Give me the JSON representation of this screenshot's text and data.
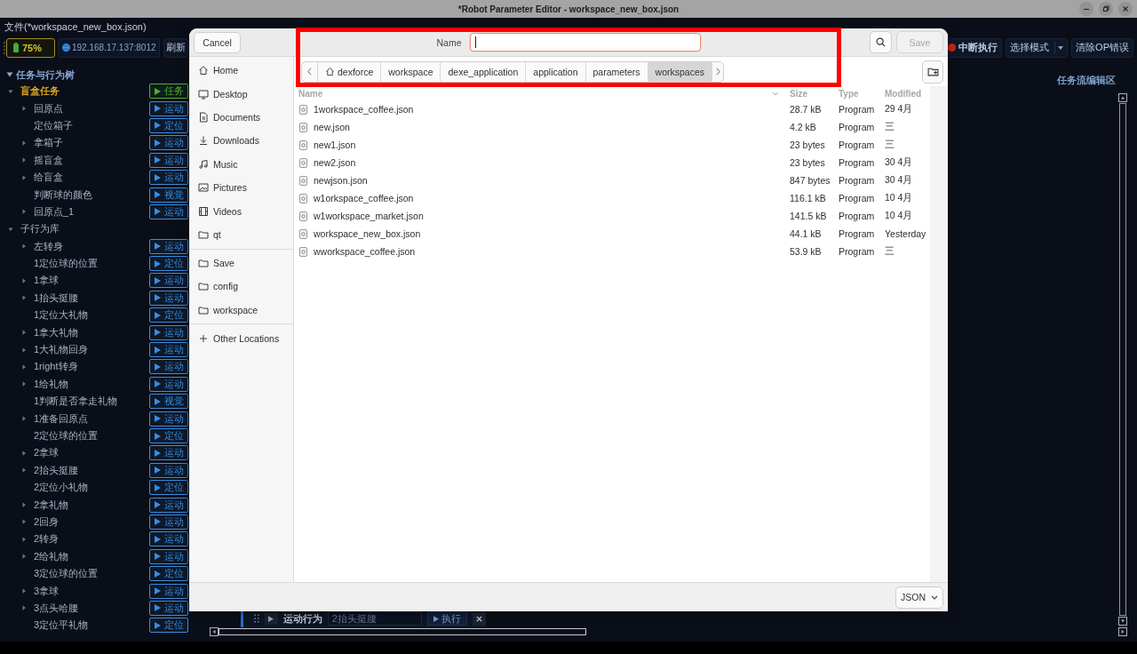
{
  "window": {
    "title": "*Robot Parameter Editor - workspace_new_box.json"
  },
  "menu": {
    "file_label": "文件(*workspace_new_box.json)"
  },
  "toolbar": {
    "battery": "75%",
    "address": "192.168.17.137:8012",
    "left_buttons": [
      {
        "label": "刷新",
        "kind": "plain"
      }
    ],
    "right_buttons": [
      {
        "label": "中断执行",
        "kind": "stop"
      },
      {
        "label": "选择模式",
        "kind": "dropdown"
      },
      {
        "label": "清除OP错误",
        "kind": "plain"
      }
    ]
  },
  "tree": {
    "title": "任务与行为树",
    "expanded": true,
    "items": [
      {
        "label": "盲盒任务",
        "selected": true,
        "expandable": true,
        "expanded": true,
        "badge": {
          "label": "任务",
          "color": "#4fb22f"
        },
        "children": [
          {
            "label": "回原点",
            "selected": false,
            "expandable": true,
            "expanded": false,
            "badge": {
              "label": "运动",
              "color": "#3a8de0"
            }
          },
          {
            "label": "定位箱子",
            "selected": false,
            "expandable": false,
            "expanded": false,
            "badge": {
              "label": "定位",
              "color": "#3a8de0"
            }
          },
          {
            "label": "拿箱子",
            "selected": false,
            "expandable": true,
            "expanded": false,
            "badge": {
              "label": "运动",
              "color": "#3a8de0"
            }
          },
          {
            "label": "摇盲盒",
            "selected": false,
            "expandable": true,
            "expanded": false,
            "badge": {
              "label": "运动",
              "color": "#3a8de0"
            }
          },
          {
            "label": "给盲盒",
            "selected": false,
            "expandable": true,
            "expanded": false,
            "badge": {
              "label": "运动",
              "color": "#3a8de0"
            }
          },
          {
            "label": "判断球的颜色",
            "selected": false,
            "expandable": false,
            "expanded": false,
            "badge": {
              "label": "视觉",
              "color": "#3a8de0"
            }
          },
          {
            "label": "回原点_1",
            "selected": false,
            "expandable": true,
            "expanded": false,
            "badge": {
              "label": "运动",
              "color": "#3a8de0"
            }
          }
        ]
      },
      {
        "label": "子行为库",
        "selected": false,
        "expandable": true,
        "expanded": true,
        "children": [
          {
            "label": "左转身",
            "selected": false,
            "expandable": true,
            "expanded": false,
            "badge": {
              "label": "运动",
              "color": "#3a8de0"
            }
          },
          {
            "label": "1定位球的位置",
            "selected": false,
            "expandable": false,
            "expanded": false,
            "badge": {
              "label": "定位",
              "color": "#3a8de0"
            }
          },
          {
            "label": "1拿球",
            "selected": false,
            "expandable": true,
            "expanded": false,
            "badge": {
              "label": "运动",
              "color": "#3a8de0"
            }
          },
          {
            "label": "1抬头挺腰",
            "selected": false,
            "expandable": true,
            "expanded": false,
            "badge": {
              "label": "运动",
              "color": "#3a8de0"
            }
          },
          {
            "label": "1定位大礼物",
            "selected": false,
            "expandable": false,
            "expanded": false,
            "badge": {
              "label": "定位",
              "color": "#3a8de0"
            }
          },
          {
            "label": "1拿大礼物",
            "selected": false,
            "expandable": true,
            "expanded": false,
            "badge": {
              "label": "运动",
              "color": "#3a8de0"
            }
          },
          {
            "label": "1大礼物回身",
            "selected": false,
            "expandable": true,
            "expanded": false,
            "badge": {
              "label": "运动",
              "color": "#3a8de0"
            }
          },
          {
            "label": "1right转身",
            "selected": false,
            "expandable": true,
            "expanded": false,
            "badge": {
              "label": "运动",
              "color": "#3a8de0"
            }
          },
          {
            "label": "1给礼物",
            "selected": false,
            "expandable": true,
            "expanded": false,
            "badge": {
              "label": "运动",
              "color": "#3a8de0"
            }
          },
          {
            "label": "1判断是否拿走礼物",
            "selected": false,
            "expandable": false,
            "expanded": false,
            "badge": {
              "label": "视觉",
              "color": "#3a8de0"
            }
          },
          {
            "label": "1准备回原点",
            "selected": false,
            "expandable": true,
            "expanded": false,
            "badge": {
              "label": "运动",
              "color": "#3a8de0"
            }
          },
          {
            "label": "2定位球的位置",
            "selected": false,
            "expandable": false,
            "expanded": false,
            "badge": {
              "label": "定位",
              "color": "#3a8de0"
            }
          },
          {
            "label": "2拿球",
            "selected": false,
            "expandable": true,
            "expanded": false,
            "badge": {
              "label": "运动",
              "color": "#3a8de0"
            }
          },
          {
            "label": "2抬头挺腰",
            "selected": false,
            "expandable": true,
            "expanded": false,
            "badge": {
              "label": "运动",
              "color": "#3a8de0"
            }
          },
          {
            "label": "2定位小礼物",
            "selected": false,
            "expandable": false,
            "expanded": false,
            "badge": {
              "label": "定位",
              "color": "#3a8de0"
            }
          },
          {
            "label": "2拿礼物",
            "selected": false,
            "expandable": true,
            "expanded": false,
            "badge": {
              "label": "运动",
              "color": "#3a8de0"
            }
          },
          {
            "label": "2回身",
            "selected": false,
            "expandable": true,
            "expanded": false,
            "badge": {
              "label": "运动",
              "color": "#3a8de0"
            }
          },
          {
            "label": "2转身",
            "selected": false,
            "expandable": true,
            "expanded": false,
            "badge": {
              "label": "运动",
              "color": "#3a8de0"
            }
          },
          {
            "label": "2给礼物",
            "selected": false,
            "expandable": true,
            "expanded": false,
            "badge": {
              "label": "运动",
              "color": "#3a8de0"
            }
          },
          {
            "label": "3定位球的位置",
            "selected": false,
            "expandable": false,
            "expanded": false,
            "badge": {
              "label": "定位",
              "color": "#3a8de0"
            }
          },
          {
            "label": "3拿球",
            "selected": false,
            "expandable": true,
            "expanded": false,
            "badge": {
              "label": "运动",
              "color": "#3a8de0"
            }
          },
          {
            "label": "3点头哈腰",
            "selected": false,
            "expandable": true,
            "expanded": false,
            "badge": {
              "label": "运动",
              "color": "#3a8de0"
            }
          },
          {
            "label": "3定位平礼物",
            "selected": false,
            "expandable": false,
            "expanded": false,
            "badge": {
              "label": "定位",
              "color": "#3a8de0"
            }
          }
        ]
      }
    ]
  },
  "editor": {
    "title": "任务流编辑区",
    "steps": [
      {
        "kind": "motion",
        "label": "运动行为",
        "value": "2抬头挺腰",
        "run_label": "执行"
      }
    ]
  },
  "dialog": {
    "cancel_label": "Cancel",
    "name_field": {
      "label": "Name",
      "focused": true
    },
    "save_button": {
      "label": "Save",
      "disabled": true
    },
    "places": [
      {
        "items": [
          {
            "label": "Home",
            "kind": "home"
          },
          {
            "label": "Desktop",
            "kind": "desktop"
          },
          {
            "label": "Documents",
            "kind": "documents"
          },
          {
            "label": "Downloads",
            "kind": "downloads"
          },
          {
            "label": "Music",
            "kind": "music"
          },
          {
            "label": "Pictures",
            "kind": "pictures"
          },
          {
            "label": "Videos",
            "kind": "videos"
          },
          {
            "label": "qt",
            "kind": "folder"
          }
        ]
      },
      {
        "items": [
          {
            "label": "Save",
            "kind": "folder"
          },
          {
            "label": "config",
            "kind": "folder"
          },
          {
            "label": "workspace",
            "kind": "folder"
          }
        ]
      },
      {
        "items": [
          {
            "label": "Other Locations",
            "kind": "other"
          }
        ]
      }
    ],
    "path": [
      {
        "label": "dexforce",
        "kind": "home",
        "selected": false
      },
      {
        "label": "workspace",
        "kind": "folder",
        "selected": false
      },
      {
        "label": "dexe_application",
        "kind": "folder",
        "selected": false
      },
      {
        "label": "application",
        "kind": "folder",
        "selected": false
      },
      {
        "label": "parameters",
        "kind": "folder",
        "selected": false
      },
      {
        "label": "workspaces",
        "kind": "folder",
        "selected": true
      }
    ],
    "columns": [
      {
        "label": "Name",
        "sorted": true
      },
      {
        "label": "Size",
        "sorted": false
      },
      {
        "label": "Type",
        "sorted": false
      },
      {
        "label": "Modified",
        "sorted": false
      }
    ],
    "files": [
      {
        "name": "1workspace_coffee.json",
        "size": "28.7 kB",
        "type": "Program",
        "modified": "29 4月"
      },
      {
        "name": "new.json",
        "size": "4.2 kB",
        "type": "Program",
        "modified": "三"
      },
      {
        "name": "new1.json",
        "size": "23 bytes",
        "type": "Program",
        "modified": "三"
      },
      {
        "name": "new2.json",
        "size": "23 bytes",
        "type": "Program",
        "modified": "30 4月"
      },
      {
        "name": "newjson.json",
        "size": "847 bytes",
        "type": "Program",
        "modified": "30 4月"
      },
      {
        "name": "w1orkspace_coffee.json",
        "size": "116.1 kB",
        "type": "Program",
        "modified": "10 4月"
      },
      {
        "name": "w1workspace_market.json",
        "size": "141.5 kB",
        "type": "Program",
        "modified": "10 4月"
      },
      {
        "name": "workspace_new_box.json",
        "size": "44.1 kB",
        "type": "Program",
        "modified": "Yesterday"
      },
      {
        "name": "wworkspace_coffee.json",
        "size": "53.9 kB",
        "type": "Program",
        "modified": "三"
      }
    ],
    "filter": "JSON"
  },
  "overlay": {
    "highlight_frame": true
  }
}
